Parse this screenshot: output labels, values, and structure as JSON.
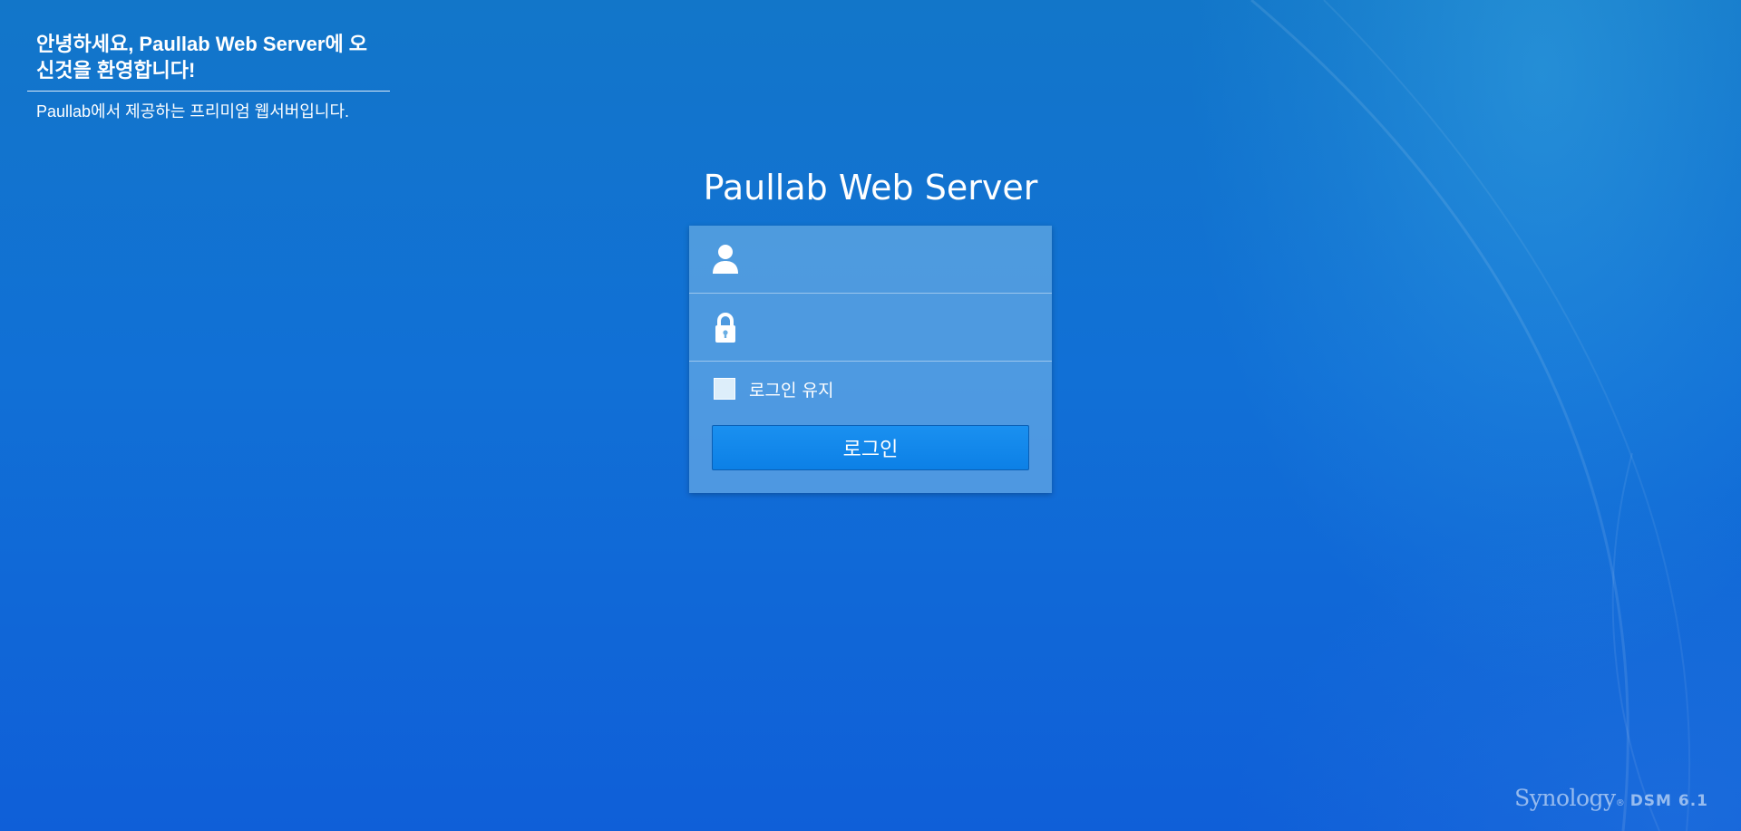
{
  "welcome": {
    "title": "안녕하세요, Paullab Web Server에 오신것을 환영합니다!",
    "description": "Paullab에서 제공하는 프리미엄 웹서버입니다."
  },
  "product": {
    "title": "Paullab Web Server"
  },
  "login": {
    "username_value": "",
    "password_value": "",
    "remember_label": "로그인 유지",
    "remember_checked": false,
    "submit_label": "로그인"
  },
  "brand": {
    "logo_text": "Synology",
    "version_text": "DSM 6.1"
  },
  "icons": {
    "username": "user-icon",
    "password": "lock-icon"
  },
  "colors": {
    "background": "#1170d6",
    "button": "#0c80e6",
    "card": "#8cc3eb"
  }
}
